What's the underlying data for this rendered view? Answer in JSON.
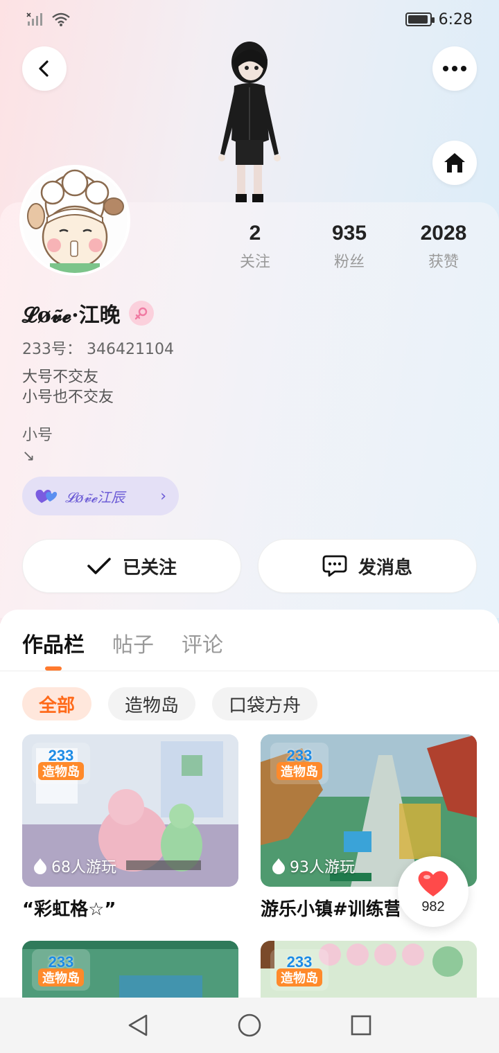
{
  "status_bar": {
    "time": "6:28"
  },
  "header": {
    "back_icon": "chevron-left-icon",
    "more_icon": "more-horizontal-icon",
    "home_icon": "home-icon"
  },
  "profile": {
    "stats": [
      {
        "value": "2",
        "label": "关注"
      },
      {
        "value": "935",
        "label": "粉丝"
      },
      {
        "value": "2028",
        "label": "获赞"
      }
    ],
    "name": "𝓛ø𝓿̃𝓮·江晚",
    "gender_icon": "female-icon",
    "uid": "233号： 346421104",
    "bio_line1": "大号不交友",
    "bio_line2": "小号也不交友",
    "alt_label": "小号",
    "alt_arrow": "↘",
    "linked_account": "𝓛ø𝓿̃𝓮江辰"
  },
  "actions": {
    "follow_label": "已关注",
    "message_label": "发消息"
  },
  "tabs": [
    "作品栏",
    "帖子",
    "评论"
  ],
  "filters": [
    "全部",
    "造物岛",
    "口袋方舟"
  ],
  "games": [
    {
      "title": "“彩虹格☆”",
      "plays": "68人游玩",
      "badge_top": "233",
      "badge_bottom": "造物岛"
    },
    {
      "title": "游乐小镇#训练营",
      "plays": "93人游玩",
      "badge_top": "233",
      "badge_bottom": "造物岛"
    },
    {
      "title": "",
      "plays": "",
      "badge_top": "233",
      "badge_bottom": "造物岛"
    },
    {
      "title": "",
      "plays": "",
      "badge_top": "233",
      "badge_bottom": "造物岛"
    }
  ],
  "like_fab": {
    "count": "982"
  },
  "colors": {
    "accent": "#ff7a2e",
    "chip_active_bg": "#ffe7dc",
    "linked_bg": "#e4e0f6",
    "linked_fg": "#6b5bd6"
  }
}
